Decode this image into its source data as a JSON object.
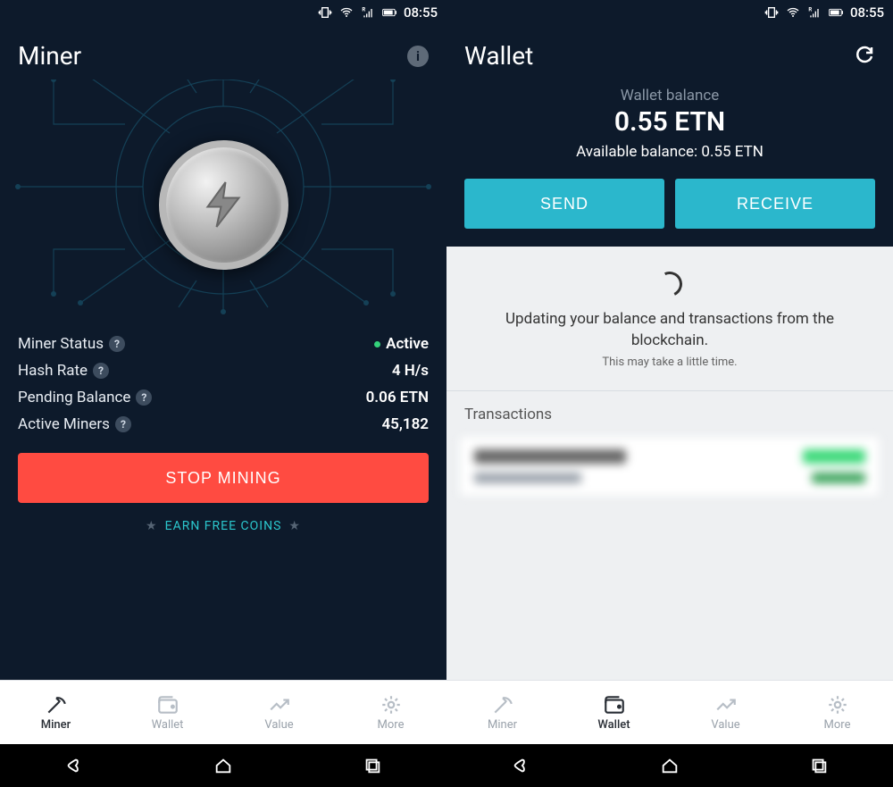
{
  "status": {
    "time": "08:55"
  },
  "miner": {
    "title": "Miner",
    "stats": {
      "status_label": "Miner Status",
      "status_value": "Active",
      "hash_label": "Hash Rate",
      "hash_value": "4 H/s",
      "pending_label": "Pending Balance",
      "pending_value": "0.06 ETN",
      "activeminers_label": "Active Miners",
      "activeminers_value": "45,182"
    },
    "stop_label": "STOP MINING",
    "earn_label": "EARN FREE COINS"
  },
  "wallet": {
    "title": "Wallet",
    "balance_label": "Wallet balance",
    "balance_value": "0.55 ETN",
    "available_label": "Available balance: 0.55 ETN",
    "send_label": "SEND",
    "receive_label": "RECEIVE",
    "updating_title": "Updating your balance and transactions from the blockchain.",
    "updating_sub": "This may take a little time.",
    "tx_header": "Transactions"
  },
  "tabs": {
    "miner": "Miner",
    "wallet": "Wallet",
    "value": "Value",
    "more": "More"
  }
}
